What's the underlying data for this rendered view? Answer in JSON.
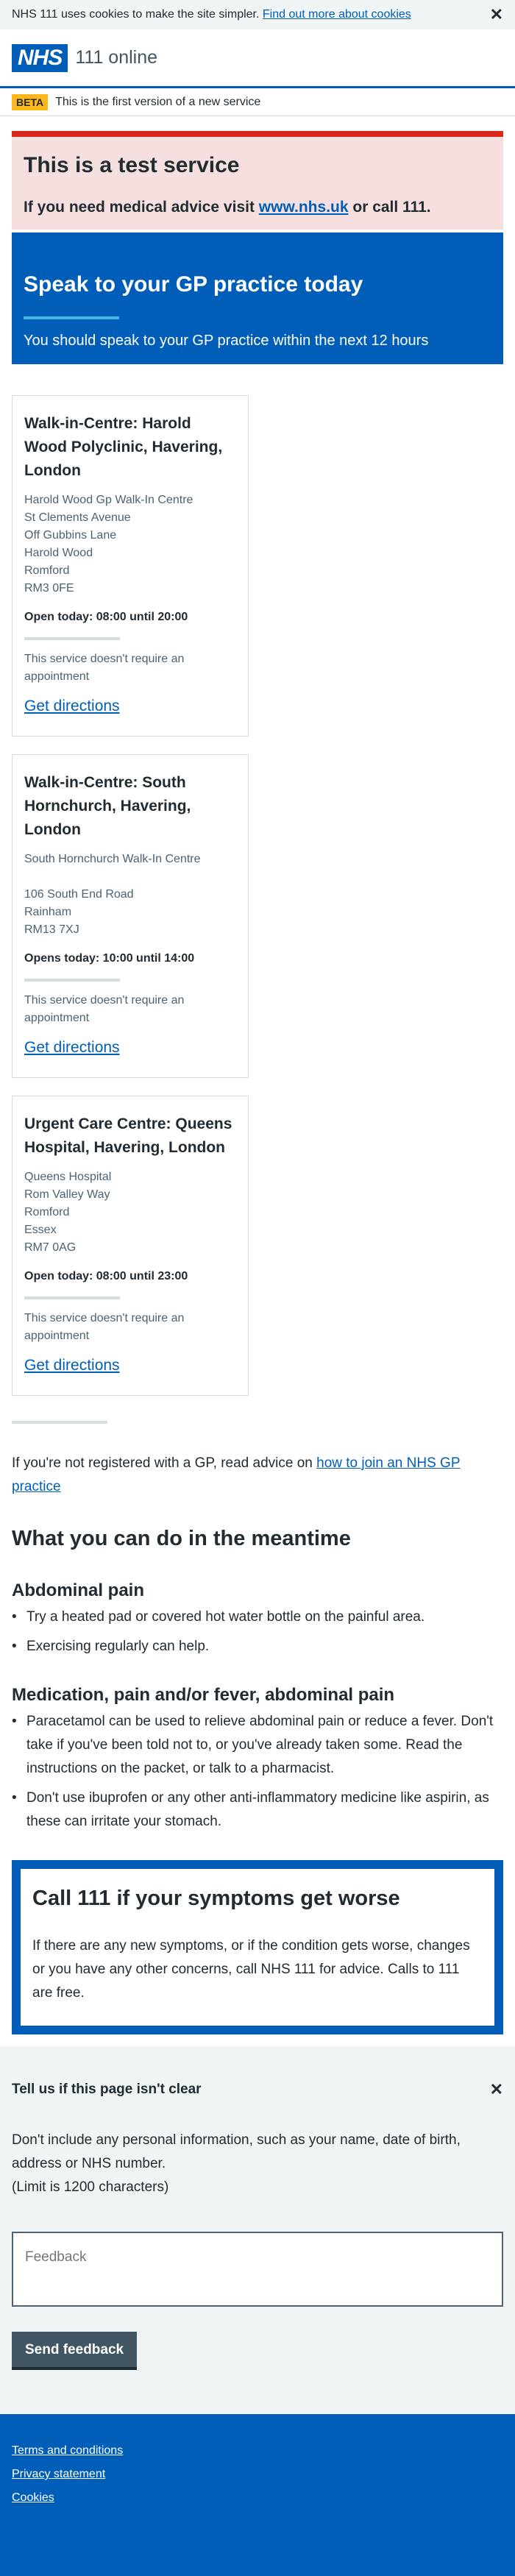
{
  "cookie_banner": {
    "text": "NHS 111 uses cookies to make the site simpler.",
    "link": "Find out more about cookies",
    "close": "✕"
  },
  "header": {
    "logo": "NHS",
    "service_name": "111 online"
  },
  "phase_banner": {
    "tag": "BETA",
    "text": "This is the first version of a new service"
  },
  "test_banner": {
    "title": "This is a test service",
    "text_before": "If you need medical advice visit ",
    "link": "www.nhs.uk",
    "text_after": " or call 111."
  },
  "care_card": {
    "title": "Speak to your GP practice today",
    "text": "You should speak to your GP practice within the next 12 hours"
  },
  "services": [
    {
      "title": "Walk-in-Centre: Harold Wood Polyclinic, Havering, London",
      "address": [
        "Harold Wood Gp Walk-In Centre",
        "St Clements Avenue",
        "Off Gubbins Lane",
        "Harold Wood",
        "Romford",
        "RM3 0FE"
      ],
      "opening": "Open today: 08:00 until 20:00",
      "note": "This service doesn't require an appointment",
      "directions": "Get directions"
    },
    {
      "title": "Walk-in-Centre: South Hornchurch, Havering, London",
      "address": [
        "South Hornchurch Walk-In Centre",
        "",
        "106 South End Road",
        "Rainham",
        "RM13 7XJ"
      ],
      "opening": "Opens today: 10:00 until 14:00",
      "note": "This service doesn't require an appointment",
      "directions": "Get directions"
    },
    {
      "title": "Urgent Care Centre: Queens Hospital, Havering, London",
      "address": [
        "Queens Hospital",
        "Rom Valley Way",
        "Romford",
        "Essex",
        "RM7 0AG"
      ],
      "opening": "Open today: 08:00 until 23:00",
      "note": "This service doesn't require an appointment",
      "directions": "Get directions"
    }
  ],
  "gp_advice": {
    "text": "If you're not registered with a GP, read advice on ",
    "link": "how to join an NHS GP practice"
  },
  "meantime": {
    "title": "What you can do in the meantime",
    "sections": [
      {
        "heading": "Abdominal pain",
        "items": [
          "Try a heated pad or covered hot water bottle on the painful area.",
          "Exercising regularly can help."
        ]
      },
      {
        "heading": "Medication, pain and/or fever, abdominal pain",
        "items": [
          "Paracetamol can be used to relieve abdominal pain or reduce a fever. Don't take if you've been told not to, or you've already taken some. Read the instructions on the packet, or talk to a pharmacist.",
          "Don't use ibuprofen or any other anti-inflammatory medicine like aspirin, as these can irritate your stomach."
        ]
      }
    ]
  },
  "callout": {
    "title": "Call 111 if your symptoms get worse",
    "text": "If there are any new symptoms, or if the condition gets worse, changes or you have any other concerns, call NHS 111 for advice. Calls to 111 are free."
  },
  "feedback": {
    "title": "Tell us if this page isn't clear",
    "close": "✕",
    "text": "Don't include any personal information, such as your name, date of birth, address or NHS number.",
    "limit": "(Limit is 1200 characters)",
    "placeholder": "Feedback",
    "button": "Send feedback"
  },
  "footer": {
    "links": [
      "Terms and conditions",
      "Privacy statement",
      "Cookies"
    ]
  },
  "colors": {
    "nhs_blue": "#005eb8",
    "red": "#da291c",
    "warm_yellow": "#ffb81c",
    "pale_grey": "#f0f4f5"
  }
}
